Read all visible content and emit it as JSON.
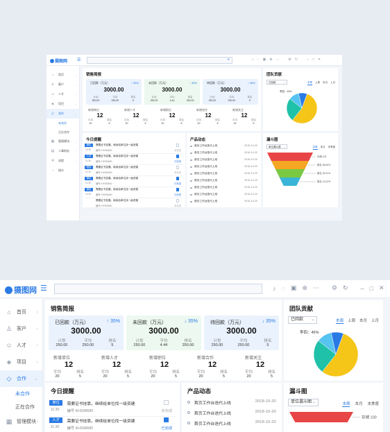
{
  "app": {
    "logo_text": "摄图网"
  },
  "sidebar": {
    "items": [
      {
        "label": "首页",
        "icon": "home-icon"
      },
      {
        "label": "客户",
        "icon": "user-icon"
      },
      {
        "label": "人才",
        "icon": "person-icon"
      },
      {
        "label": "项目",
        "icon": "layers-icon"
      },
      {
        "label": "合作",
        "icon": "diamond-icon"
      },
      {
        "label": "管理模块",
        "icon": "grid-icon"
      },
      {
        "label": "人事财务",
        "icon": "briefcase-icon"
      },
      {
        "label": "流程",
        "icon": "gear-icon"
      },
      {
        "label": "统计",
        "icon": "chart-icon"
      }
    ],
    "sub_items": [
      "未合作",
      "正在合作"
    ]
  },
  "sales": {
    "title": "销售简报",
    "kpis": [
      {
        "label": "已回款（万元）",
        "change": "35%",
        "value": "3000.00",
        "sub_labels": [
          "计划",
          "平均",
          "排名"
        ],
        "sub_values": [
          "250.00",
          "250.00",
          "5"
        ]
      },
      {
        "label": "未回款（万元）",
        "change": "35%",
        "value": "3000.00",
        "sub_labels": [
          "计划",
          "平均",
          "排名"
        ],
        "sub_values": [
          "250.00",
          "4.44",
          "250.00"
        ]
      },
      {
        "label": "待回款（万元）",
        "change": "35%",
        "value": "3000.00",
        "sub_labels": [
          "计划",
          "平均",
          "排名"
        ],
        "sub_values": [
          "250.00",
          "250.00",
          "5"
        ]
      }
    ],
    "stats": [
      {
        "label": "新增单位",
        "value": "12",
        "sub_labels": [
          "平均",
          "排名"
        ],
        "sub_values": [
          "20",
          "5"
        ]
      },
      {
        "label": "新增人才",
        "value": "12",
        "sub_labels": [
          "平均",
          "排名"
        ],
        "sub_values": [
          "20",
          "5"
        ]
      },
      {
        "label": "新增职位",
        "value": "12",
        "sub_labels": [
          "平均",
          "排名"
        ],
        "sub_values": [
          "20",
          "5"
        ]
      },
      {
        "label": "新增合作",
        "value": "12",
        "sub_labels": [
          "平均",
          "排名"
        ],
        "sub_values": [
          "20",
          "5"
        ]
      },
      {
        "label": "新增关注",
        "value": "12",
        "sub_labels": [
          "平均",
          "排名"
        ],
        "sub_values": [
          "20",
          "5"
        ]
      }
    ]
  },
  "reminders": {
    "title": "今日提醒",
    "items": [
      {
        "badge": "单位",
        "time": "11:30",
        "text": "需要证书挂靠，继续给单位找一级资建",
        "code": "编号 KHS98680",
        "checked": false,
        "status": "未完成"
      },
      {
        "badge": "人才",
        "time": "11:30",
        "text": "需要证书挂靠，继续给单位找一级资建",
        "code": "编号 KHS98680",
        "checked": true,
        "status": "已完成"
      },
      {
        "badge": "项目",
        "time": "11:30",
        "text": "需要证书挂靠，继续给单位找一级资建",
        "code": "编号 KHS98680",
        "checked": false,
        "status": "未完成"
      },
      {
        "badge": "单位",
        "time": "11:30",
        "text": "需要证书挂靠，继续给单位找一级资建",
        "code": "编号 KHS98680",
        "checked": true,
        "status": "已完成"
      },
      {
        "badge": "单位",
        "time": "11:30",
        "text": "需要证书挂靠，继续给单位找一级资建",
        "code": "编号 KHS98680",
        "checked": true,
        "status": "已完成"
      },
      {
        "badge": "",
        "time": "",
        "text": "需要证书挂靠，继续给单位找一级资建",
        "code": "编号 KHS98680",
        "checked": false,
        "status": "未完成"
      }
    ]
  },
  "products": {
    "title": "产品动态",
    "items": [
      {
        "text": "首页工作台迭代上线",
        "date": "2018-10-20"
      },
      {
        "text": "首页工作台迭代上线",
        "date": "2018-10-20"
      },
      {
        "text": "首页工作台迭代上线",
        "date": "2018-10-20"
      },
      {
        "text": "首页工作台迭代上线",
        "date": "2018-10-20"
      },
      {
        "text": "首页工作台迭代上线",
        "date": "2018-10-20"
      },
      {
        "text": "首页工作台迭代上线",
        "date": "2018-10-20"
      },
      {
        "text": "首页工作台迭代上线",
        "date": "2018-10-20"
      },
      {
        "text": "首页工作台迭代上线",
        "date": "2018-10-20"
      },
      {
        "text": "首页工作台迭代上线",
        "date": "2018-10-20"
      }
    ]
  },
  "team": {
    "title": "团队贡献",
    "select": "已回款",
    "tabs": [
      "本周",
      "上周",
      "本月",
      "上月"
    ],
    "active_tab": "本周"
  },
  "funnel": {
    "title": "漏斗图",
    "select": "单位漏斗图",
    "tabs": [
      "本周",
      "本月",
      "本季度"
    ],
    "active_tab": "本周"
  },
  "chart_data": [
    {
      "type": "pie",
      "title": "团队贡献",
      "categories": [
        "",
        "李四",
        "",
        ""
      ],
      "values": [
        55,
        45,
        0,
        0
      ],
      "label_texts": [
        "李四：45%"
      ],
      "colors": [
        "#f5c518",
        "#1fc1a8",
        "#56c3f0",
        "#2a7ae4"
      ],
      "slices": [
        {
          "value": 55,
          "color": "#f5c518"
        },
        {
          "value": 25,
          "color": "#1fc1a8"
        },
        {
          "value": 11,
          "color": "#56c3f0"
        },
        {
          "value": 9,
          "color": "#2a7ae4"
        }
      ]
    },
    {
      "type": "funnel",
      "title": "漏斗图",
      "stage_labels": [
        "存储 100",
        "报名 86.66%",
        "报名 36.22%",
        "报名 16.22%"
      ],
      "values": [
        100,
        86.66,
        36.22,
        16.22
      ],
      "colors": [
        "#e84646",
        "#f5a623",
        "#7ac943",
        "#3ab5d8"
      ]
    }
  ]
}
